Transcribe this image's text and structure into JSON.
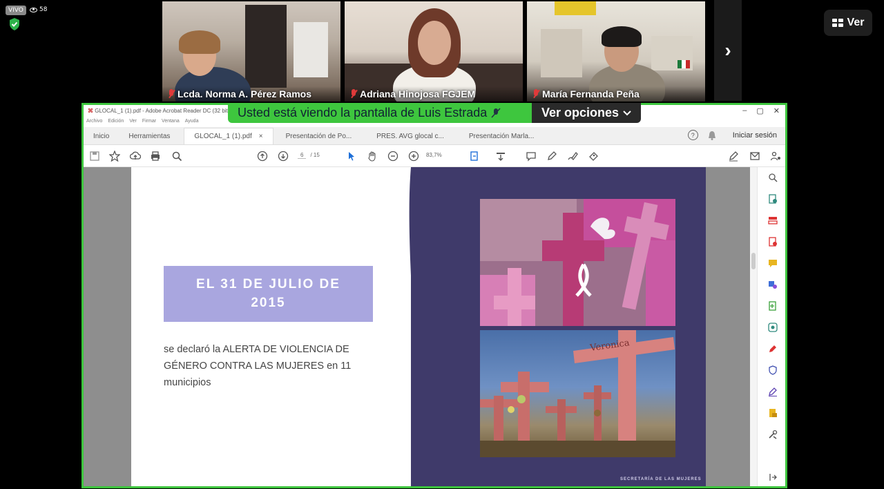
{
  "meeting": {
    "live_label": "VIVO",
    "viewer_count": "58",
    "next_label": "›",
    "view_button": "Ver"
  },
  "participants": [
    {
      "name": "Lcda. Norma A. Pérez Ramos"
    },
    {
      "name": "Adriana Hinojosa FGJEM"
    },
    {
      "name": "María Fernanda Peña"
    }
  ],
  "share": {
    "banner_text": "Usted está viendo la pantalla de Luis Estrada",
    "options_label": "Ver opciones"
  },
  "acrobat": {
    "window_title": "GLOCAL_1 (1).pdf - Adobe Acrobat Reader DC (32 bit)",
    "menus": [
      "Archivo",
      "Edición",
      "Ver",
      "Firmar",
      "Ventana",
      "Ayuda"
    ],
    "home_tab": "Inicio",
    "tools_tab": "Herramientas",
    "doc_tabs": [
      {
        "label": "GLOCAL_1 (1).pdf",
        "active": true
      },
      {
        "label": "Presentación de Po...",
        "active": false
      },
      {
        "label": "PRES. AVG glocal c...",
        "active": false
      },
      {
        "label": "Presentación Marla...",
        "active": false
      }
    ],
    "signin": "Iniciar sesión",
    "help": "?",
    "current_page": "6",
    "total_pages": "/ 15",
    "zoom": "83,7%"
  },
  "slide": {
    "heading": "EL 31 DE JULIO DE 2015",
    "body": "se declaró la ALERTA DE VIOLENCIA DE GÉNERO CONTRA LAS MUJERES en 11 municipios",
    "footer": "SECRETARÍA DE LAS MUJERES",
    "cross_word": "Veronica"
  },
  "colors": {
    "share_border": "#3ec63e",
    "panel": "#3f3a6a",
    "heading_box": "#a9a6df"
  }
}
